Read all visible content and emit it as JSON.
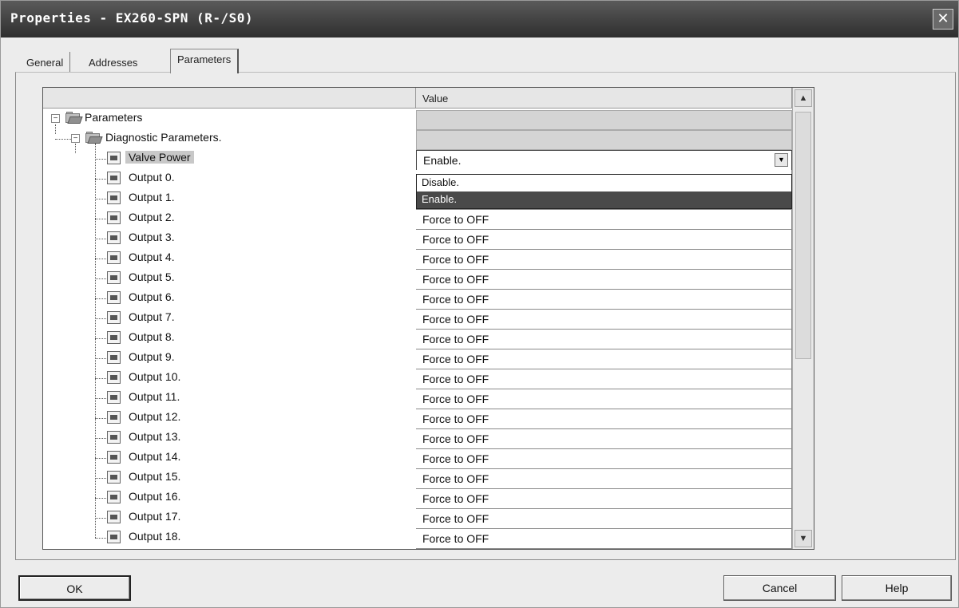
{
  "window": {
    "title": "Properties - EX260-SPN (R-/S0)",
    "close_glyph": "✕"
  },
  "tabs": [
    {
      "label": "General"
    },
    {
      "label": "Addresses"
    },
    {
      "label": "Parameters",
      "active": true
    }
  ],
  "grid": {
    "value_header": "Value",
    "root_label": "Parameters",
    "group_label": "Diagnostic Parameters.",
    "valve_power": {
      "label": "Valve Power",
      "value": "Enable."
    },
    "dropdown_options": [
      "Disable.",
      "Enable."
    ],
    "dropdown_highlighted": "Enable.",
    "outputs": [
      {
        "label": "Output 0.",
        "value": ""
      },
      {
        "label": "Output 1.",
        "value": ""
      },
      {
        "label": "Output 2.",
        "value": "Force to OFF"
      },
      {
        "label": "Output 3.",
        "value": "Force to OFF"
      },
      {
        "label": "Output 4.",
        "value": "Force to OFF"
      },
      {
        "label": "Output 5.",
        "value": "Force to OFF"
      },
      {
        "label": "Output 6.",
        "value": "Force to OFF"
      },
      {
        "label": "Output 7.",
        "value": "Force to OFF"
      },
      {
        "label": "Output 8.",
        "value": "Force to OFF"
      },
      {
        "label": "Output 9.",
        "value": "Force to OFF"
      },
      {
        "label": "Output 10.",
        "value": "Force to OFF"
      },
      {
        "label": "Output 11.",
        "value": "Force to OFF"
      },
      {
        "label": "Output 12.",
        "value": "Force to OFF"
      },
      {
        "label": "Output 13.",
        "value": "Force to OFF"
      },
      {
        "label": "Output 14.",
        "value": "Force to OFF"
      },
      {
        "label": "Output 15.",
        "value": "Force to OFF"
      },
      {
        "label": "Output 16.",
        "value": "Force to OFF"
      },
      {
        "label": "Output 17.",
        "value": "Force to OFF"
      },
      {
        "label": "Output 18.",
        "value": "Force to OFF"
      }
    ],
    "scroll_up_glyph": "▲",
    "scroll_down_glyph": "▼",
    "combo_arrow_glyph": "▼",
    "expander_glyph": "−"
  },
  "buttons": {
    "ok": "OK",
    "cancel": "Cancel",
    "help": "Help"
  }
}
